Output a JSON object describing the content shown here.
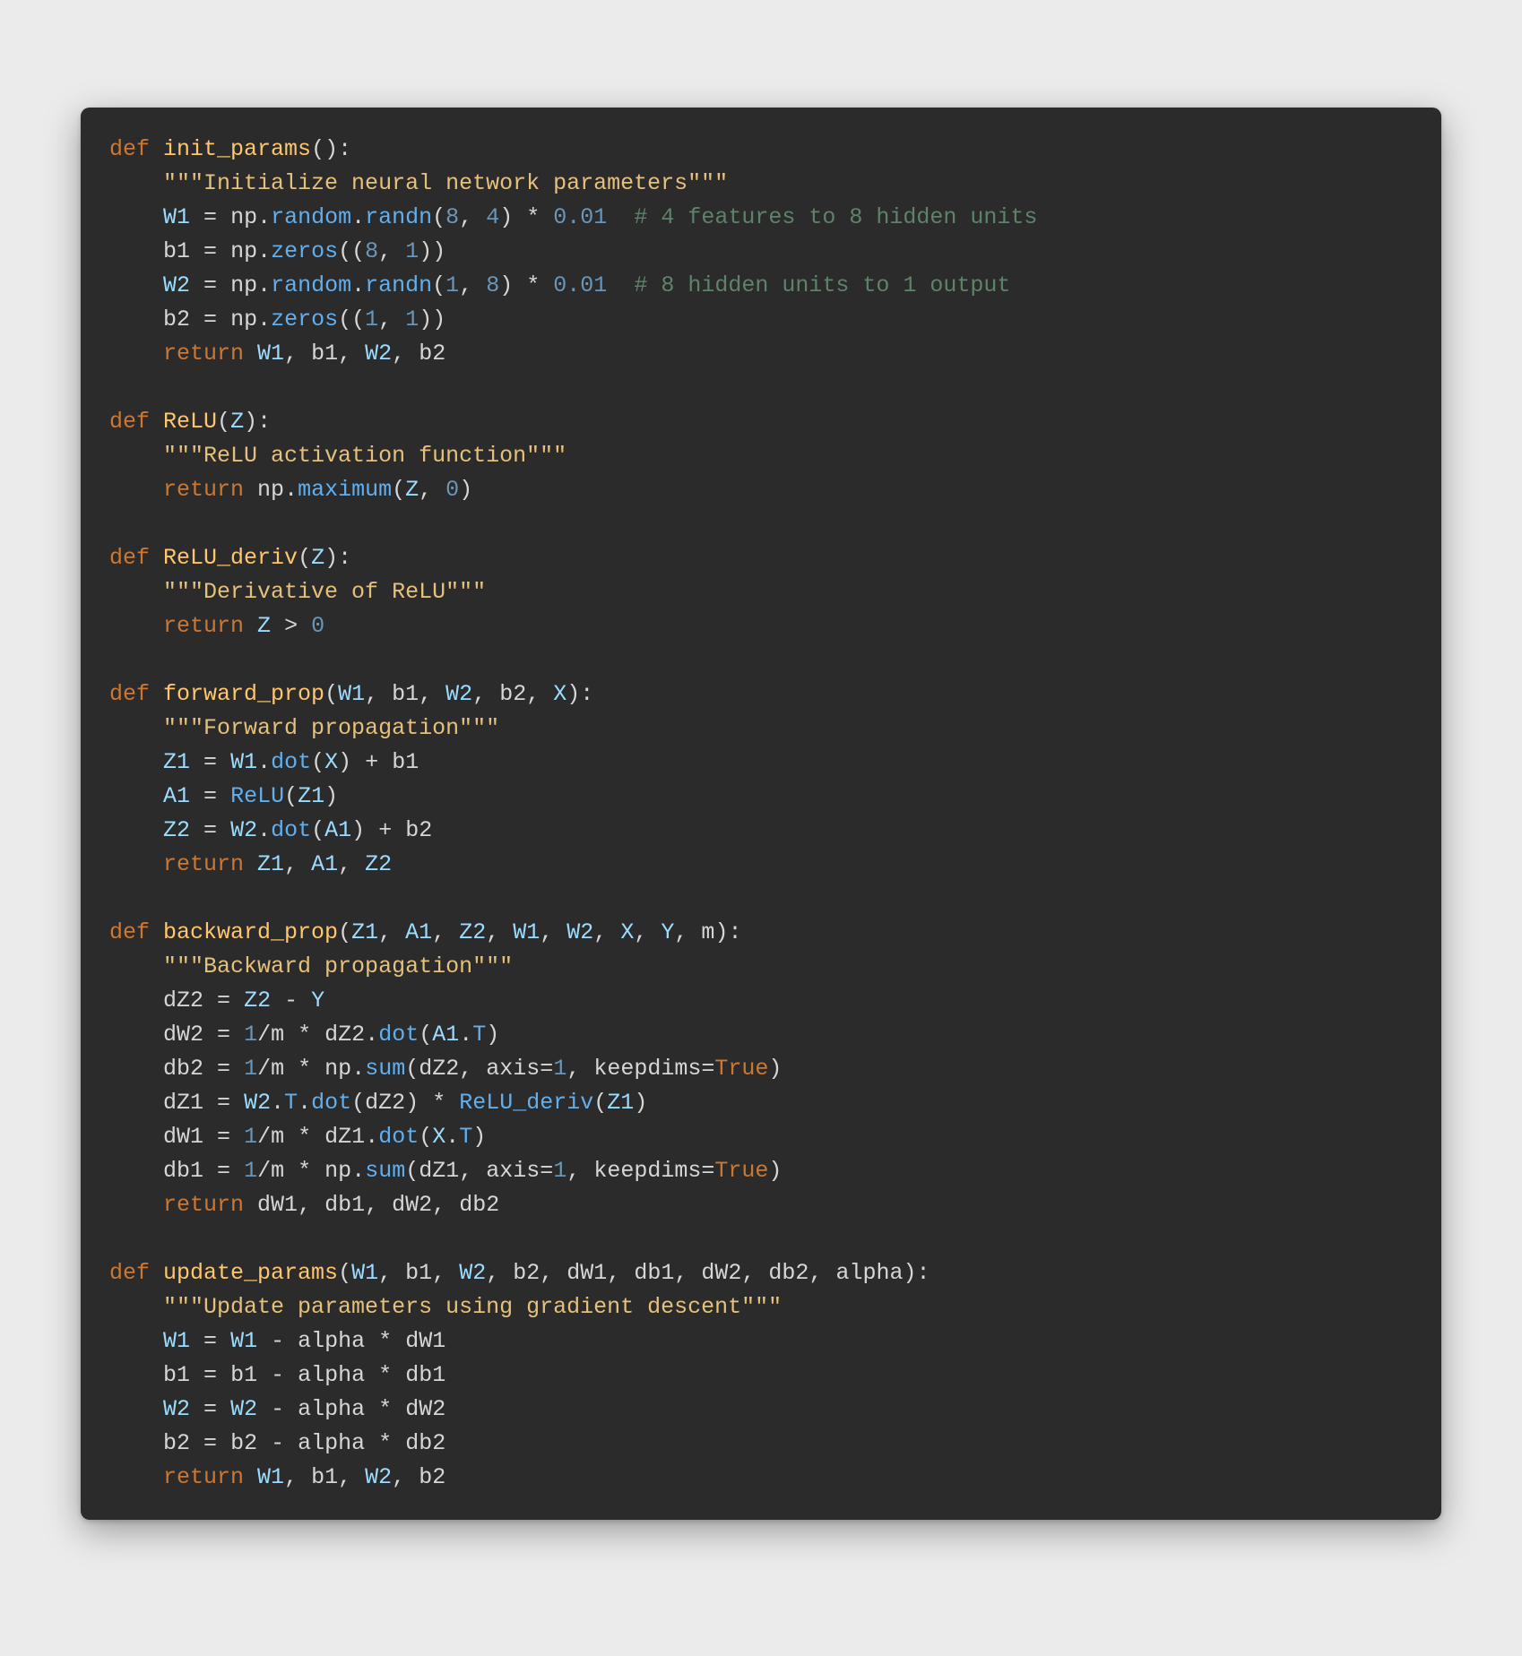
{
  "code": {
    "language": "python",
    "functions": [
      {
        "name": "init_params",
        "params": [],
        "doc": "Initialize neural network parameters",
        "body": [
          "W1 = np.random.randn(8, 4) * 0.01  # 4 features to 8 hidden units",
          "b1 = np.zeros((8, 1))",
          "W2 = np.random.randn(1, 8) * 0.01  # 8 hidden units to 1 output",
          "b2 = np.zeros((1, 1))",
          "return W1, b1, W2, b2"
        ]
      },
      {
        "name": "ReLU",
        "params": [
          "Z"
        ],
        "doc": "ReLU activation function",
        "body": [
          "return np.maximum(Z, 0)"
        ]
      },
      {
        "name": "ReLU_deriv",
        "params": [
          "Z"
        ],
        "doc": "Derivative of ReLU",
        "body": [
          "return Z > 0"
        ]
      },
      {
        "name": "forward_prop",
        "params": [
          "W1",
          "b1",
          "W2",
          "b2",
          "X"
        ],
        "doc": "Forward propagation",
        "body": [
          "Z1 = W1.dot(X) + b1",
          "A1 = ReLU(Z1)",
          "Z2 = W2.dot(A1) + b2",
          "return Z1, A1, Z2"
        ]
      },
      {
        "name": "backward_prop",
        "params": [
          "Z1",
          "A1",
          "Z2",
          "W1",
          "W2",
          "X",
          "Y",
          "m"
        ],
        "doc": "Backward propagation",
        "body": [
          "dZ2 = Z2 - Y",
          "dW2 = 1/m * dZ2.dot(A1.T)",
          "db2 = 1/m * np.sum(dZ2, axis=1, keepdims=True)",
          "dZ1 = W2.T.dot(dZ2) * ReLU_deriv(Z1)",
          "dW1 = 1/m * dZ1.dot(X.T)",
          "db1 = 1/m * np.sum(dZ1, axis=1, keepdims=True)",
          "return dW1, db1, dW2, db2"
        ]
      },
      {
        "name": "update_params",
        "params": [
          "W1",
          "b1",
          "W2",
          "b2",
          "dW1",
          "db1",
          "dW2",
          "db2",
          "alpha"
        ],
        "doc": "Update parameters using gradient descent",
        "body": [
          "W1 = W1 - alpha * dW1",
          "b1 = b1 - alpha * db1",
          "W2 = W2 - alpha * dW2",
          "b2 = b2 - alpha * db2",
          "return W1, b1, W2, b2"
        ]
      }
    ]
  }
}
